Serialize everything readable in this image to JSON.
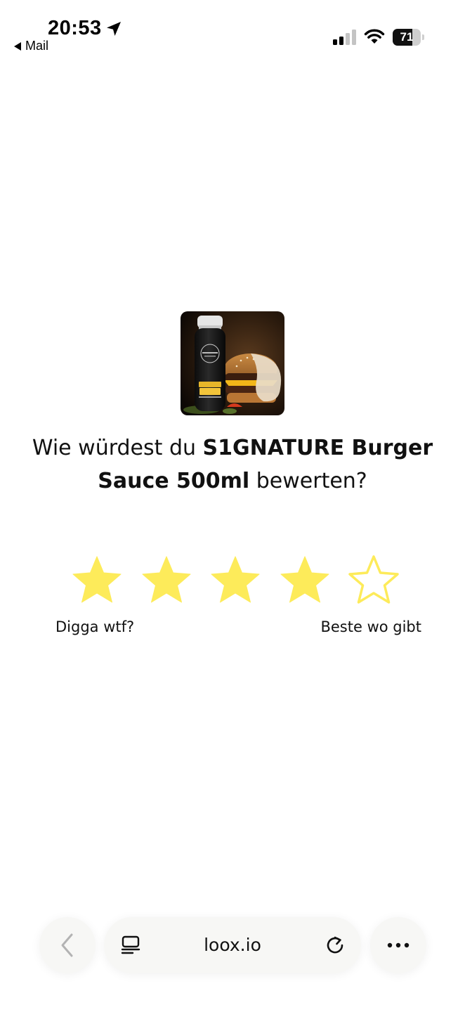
{
  "status_bar": {
    "time": "20:53",
    "back_app_label": "Mail",
    "battery_level": "71",
    "battery_fraction": 0.71,
    "icons": [
      "location-arrow-icon",
      "cellular-signal-icon",
      "wifi-icon",
      "battery-icon"
    ]
  },
  "product": {
    "image_icon": "product-photo-sauce-bottle-and-burger",
    "question_prefix": "Wie würdest du ",
    "product_name": "S1GNATURE Burger Sauce 500ml",
    "question_suffix": " bewerten?"
  },
  "rating": {
    "max": 5,
    "selected": 4,
    "filled_color": "#fdeb5a",
    "empty_color": "#fdeb5a",
    "label_low": "Digga wtf?",
    "label_high": "Beste wo gibt"
  },
  "browser": {
    "url": "loox.io",
    "icons": [
      "back-chevron-icon",
      "reader-mode-icon",
      "reload-icon",
      "more-dots-icon"
    ]
  }
}
